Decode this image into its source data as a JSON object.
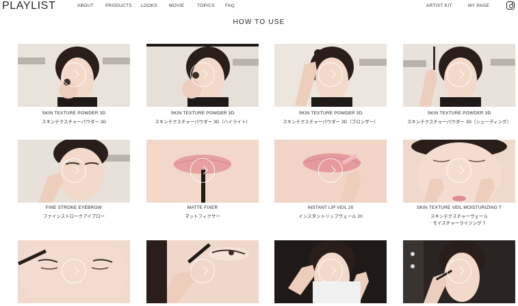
{
  "header": {
    "logo": "PLAYLIST",
    "nav": [
      "ABOUT",
      "PRODUCTS",
      "LOOKS",
      "MOVIE",
      "TOPICS",
      "FAQ"
    ],
    "right_nav": [
      "ARTIST KIT",
      "MY PAGE"
    ],
    "social_icon": "instagram-icon"
  },
  "page_title": "HOW TO USE",
  "products": [
    {
      "name": "SKIN TEXTURE POWDER 3D",
      "sub": "スキンテクスチャーパウダー 3D",
      "sub2": ""
    },
    {
      "name": "SKIN TEXTURE POWDER 3D",
      "sub": "スキンテクスチャーパウダー 3D（ハイライト）",
      "sub2": ""
    },
    {
      "name": "SKIN TEXTURE POWDER 3D",
      "sub": "スキンテクスチャーパウダー 3D（ブロンザー）",
      "sub2": ""
    },
    {
      "name": "SKIN TEXTURE POWDER 3D",
      "sub": "スキンテクスチャーパウダー 3D（シェーディング）",
      "sub2": ""
    },
    {
      "name": "FINE STROKE EYEBROW",
      "sub": "ファインストロークアイブロー",
      "sub2": ""
    },
    {
      "name": "MATTE FIXER",
      "sub": "マットフィクサー",
      "sub2": ""
    },
    {
      "name": "INSTANT LIP VEIL 20",
      "sub": "インスタントリップヴェール 20",
      "sub2": ""
    },
    {
      "name": "SKIN TEXTURE VEIL MOISTURIZING T",
      "sub": "スキンテクスチャーヴェール",
      "sub2": "モイスチャーライジング T"
    }
  ],
  "colors": {
    "background": "#ffffff",
    "text": "#222222",
    "skin": "#f1d8c9",
    "hair": "#2a1e1a"
  },
  "play_icon": "play-circle-icon"
}
